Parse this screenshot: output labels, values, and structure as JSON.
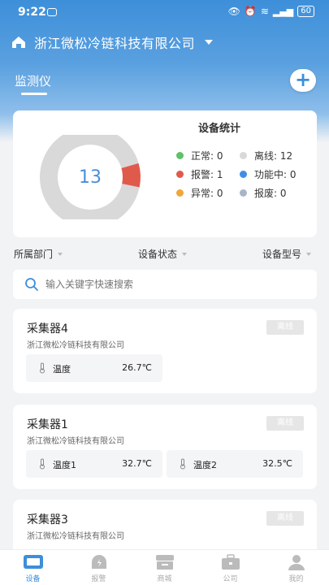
{
  "status_bar": {
    "time": "9:22",
    "battery": "60"
  },
  "header": {
    "company": "浙江微松冷链科技有限公司",
    "tab": "监测仪",
    "add_label": "+"
  },
  "stats": {
    "title": "设备统计",
    "total": "13",
    "legend": [
      {
        "label": "正常: 0",
        "color": "#5fc16a"
      },
      {
        "label": "离线: 12",
        "color": "#d9d9d9"
      },
      {
        "label": "报警: 1",
        "color": "#e05a4b"
      },
      {
        "label": "功能中: 0",
        "color": "#3f8ee3"
      },
      {
        "label": "异常: 0",
        "color": "#f0a63a"
      },
      {
        "label": "报废: 0",
        "color": "#a9b5c7"
      }
    ],
    "offline_count": 12,
    "alarm_count": 1
  },
  "filters": {
    "dept": "所属部门",
    "status": "设备状态",
    "model": "设备型号"
  },
  "search": {
    "placeholder": "输入关键字快速搜索"
  },
  "devices": [
    {
      "name": "采集器4",
      "company": "浙江微松冷链科技有限公司",
      "status": "离线",
      "sensors": [
        {
          "label": "温度",
          "value": "26.7℃"
        }
      ]
    },
    {
      "name": "采集器1",
      "company": "浙江微松冷链科技有限公司",
      "status": "离线",
      "sensors": [
        {
          "label": "温度1",
          "value": "32.7℃"
        },
        {
          "label": "温度2",
          "value": "32.5℃"
        }
      ]
    },
    {
      "name": "采集器3",
      "company": "浙江微松冷链科技有限公司",
      "status": "离线",
      "sensors": []
    }
  ],
  "nav": [
    {
      "label": "设备",
      "icon": "device-icon",
      "active": true
    },
    {
      "label": "报警",
      "icon": "alarm-icon",
      "active": false
    },
    {
      "label": "商城",
      "icon": "store-icon",
      "active": false
    },
    {
      "label": "公司",
      "icon": "company-icon",
      "active": false
    },
    {
      "label": "我的",
      "icon": "profile-icon",
      "active": false
    }
  ],
  "colors": {
    "primary": "#3d8fd9",
    "offline": "#d9d9d9",
    "alarm": "#e05a4b"
  }
}
